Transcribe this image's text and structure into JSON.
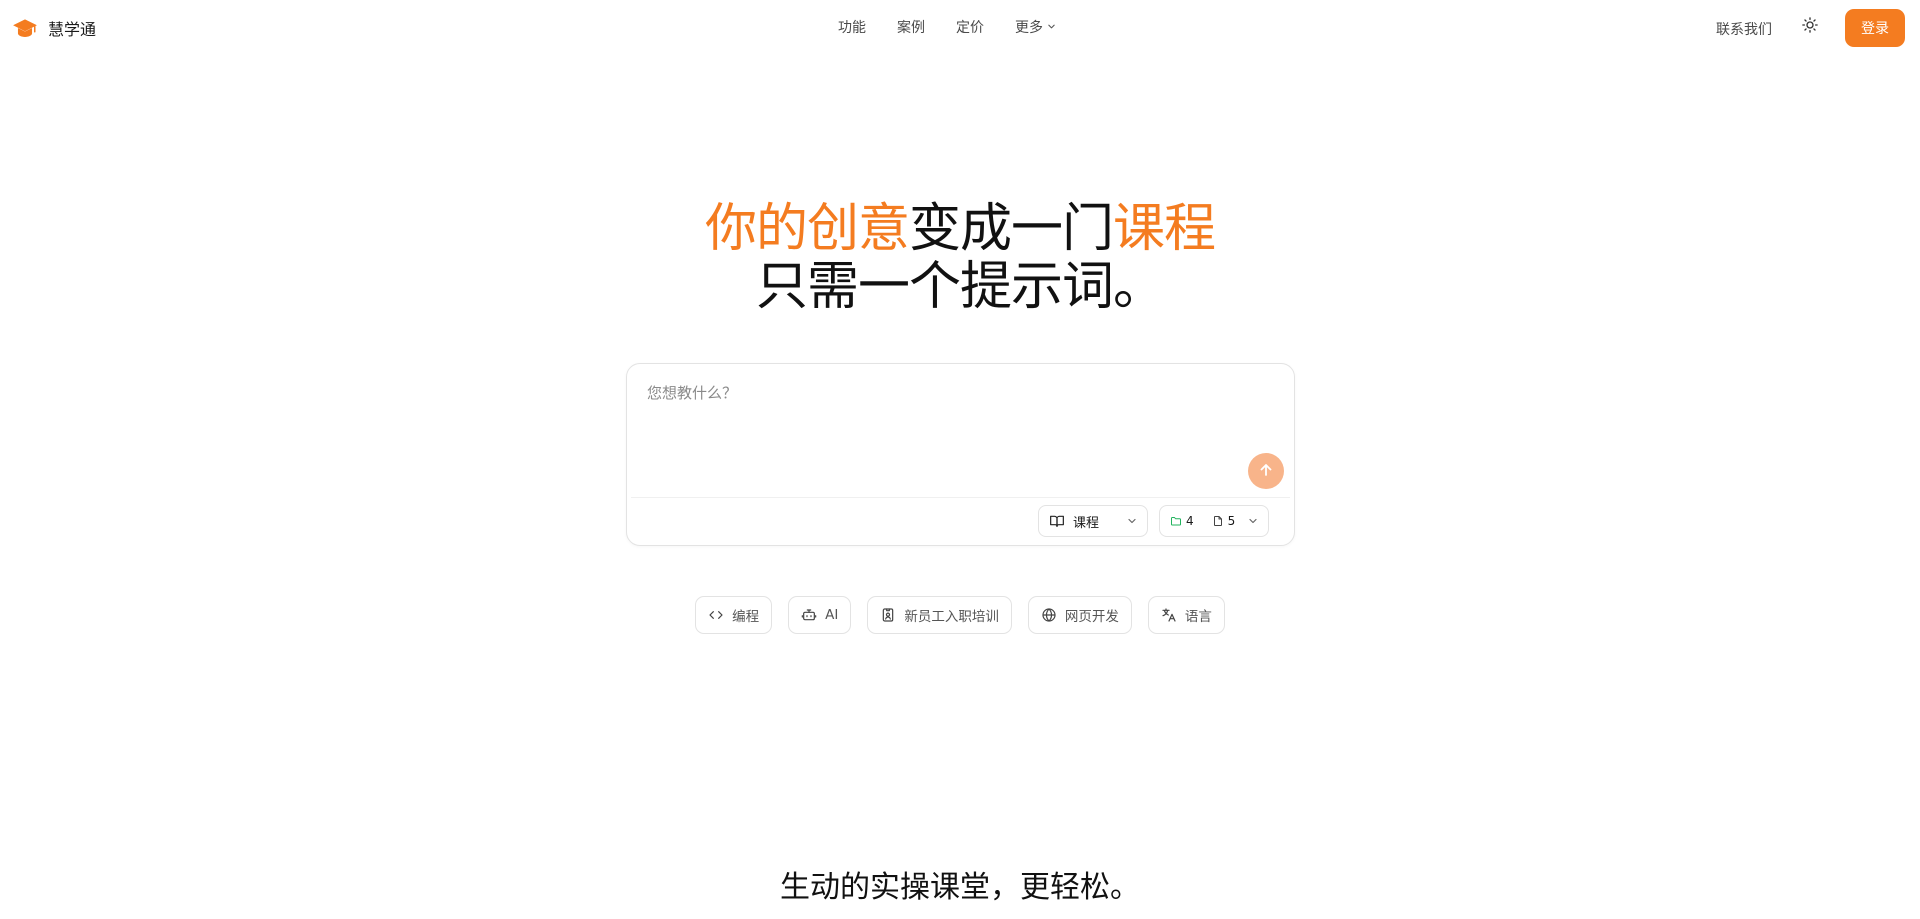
{
  "brand": {
    "name": "慧学通",
    "logo_icon": "graduation-cap-icon",
    "accent": "#f47c20"
  },
  "nav": {
    "items": [
      {
        "label": "功能"
      },
      {
        "label": "案例"
      },
      {
        "label": "定价"
      },
      {
        "label": "更多",
        "icon": "chevron-down-icon"
      }
    ]
  },
  "header": {
    "contact_label": "联系我们",
    "theme_icon": "sun-icon",
    "login_label": "登录"
  },
  "hero": {
    "line1": [
      {
        "text": "你的创意",
        "color": "#f47c20"
      },
      {
        "text": "变成一门",
        "color": "#111111"
      },
      {
        "text": "课程",
        "color": "#f47c20"
      }
    ],
    "line2": "只需一个提示词。"
  },
  "prompt": {
    "placeholder": "您想教什么？",
    "value": "",
    "send_icon": "arrow-up-icon",
    "send_color": "#f8b48a",
    "mode": {
      "icon": "book-open-icon",
      "value": "课程"
    },
    "counts": {
      "folder_icon": "folder-icon",
      "folder_count": "4",
      "file_icon": "file-icon",
      "file_count": "5"
    }
  },
  "suggestions": [
    {
      "icon": "code-icon",
      "label": "编程"
    },
    {
      "icon": "bot-icon",
      "label": "AI"
    },
    {
      "icon": "id-badge-icon",
      "label": "新员工入职培训"
    },
    {
      "icon": "globe-icon",
      "label": "网页开发"
    },
    {
      "icon": "translate-icon",
      "label": "语言"
    }
  ],
  "section": {
    "title": "生动的实操课堂，更轻松。"
  }
}
